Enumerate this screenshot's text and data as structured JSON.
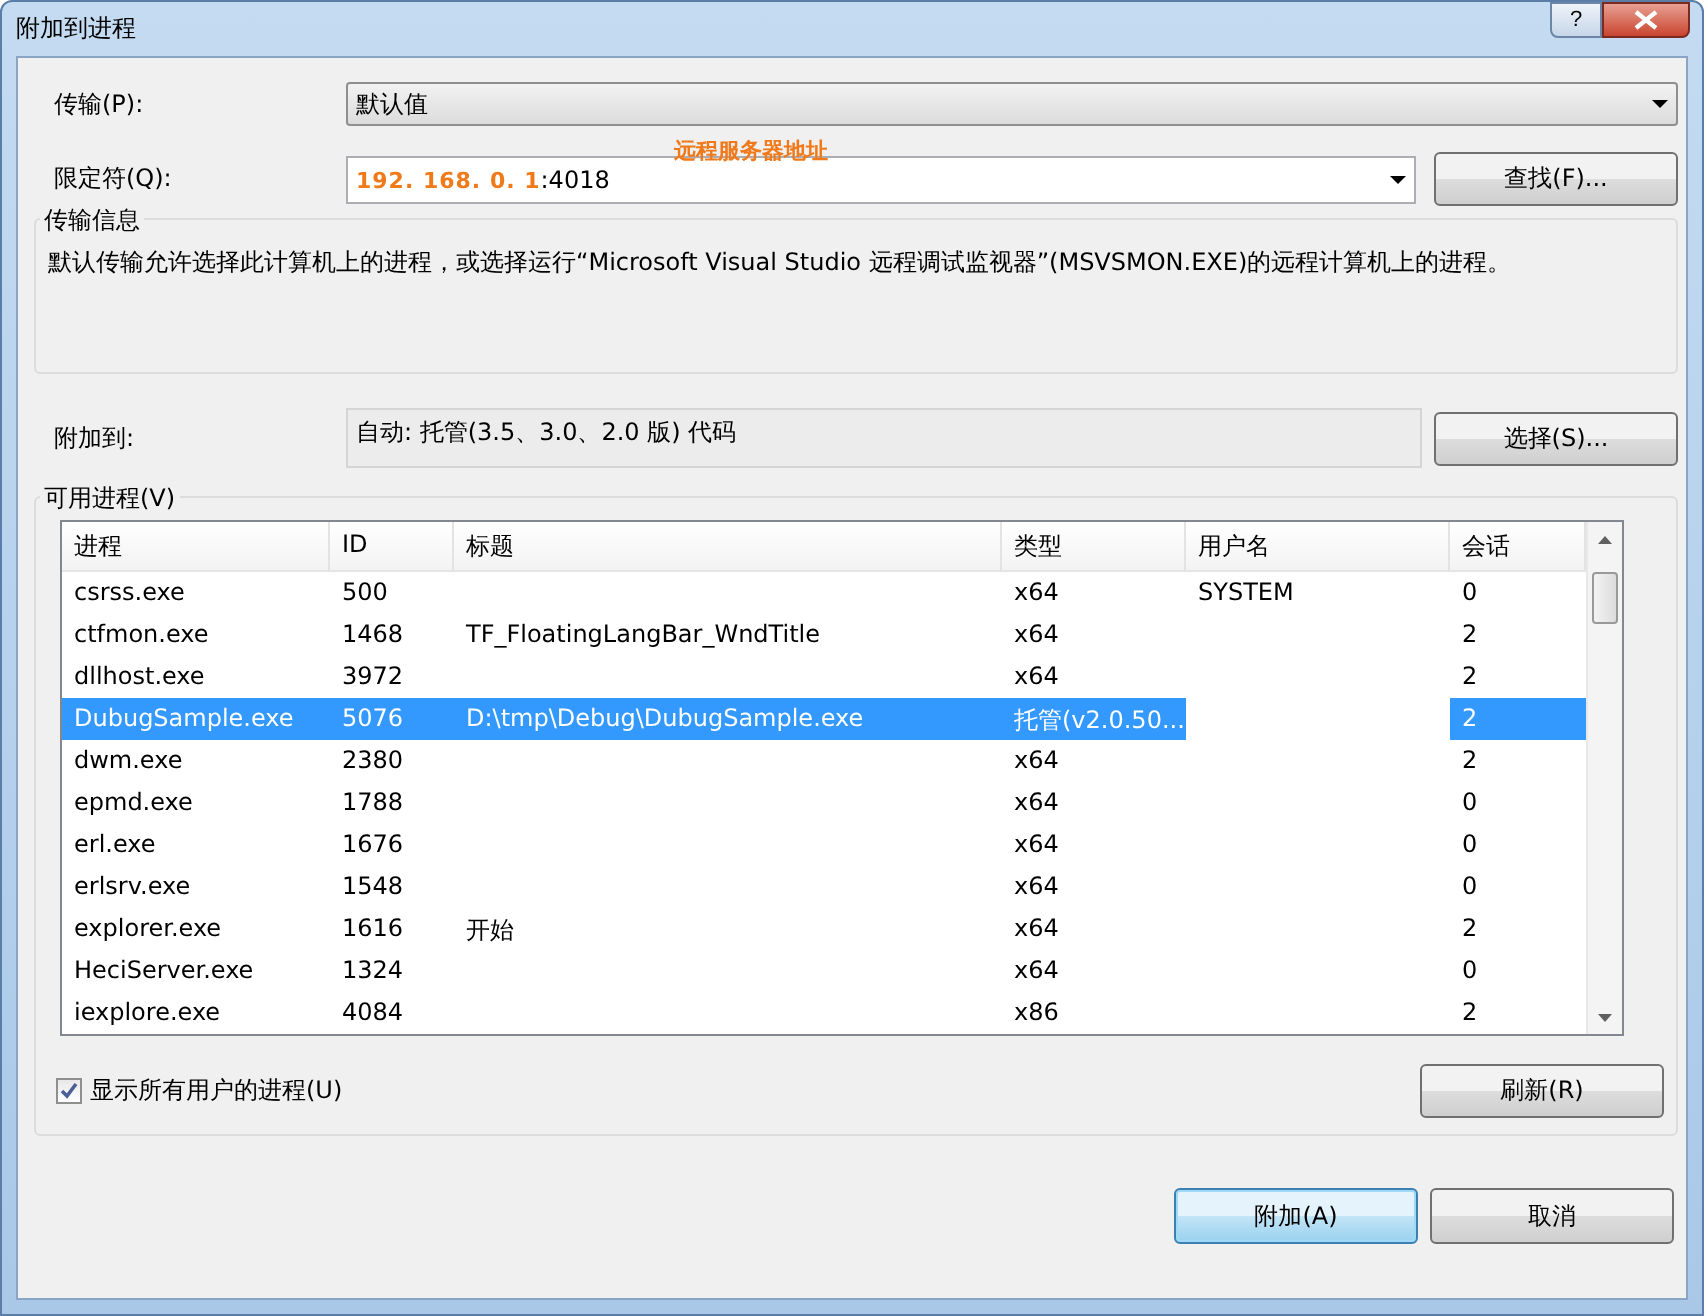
{
  "window": {
    "title": "附加到进程",
    "help_button": "?"
  },
  "transport": {
    "label": "传输(P):",
    "value": "默认值"
  },
  "qualifier": {
    "label": "限定符(Q):",
    "value": "**192. 168. 0. 1**:4018",
    "annotation": "远程服务器地址",
    "button": "查找(F)..."
  },
  "transport_info": {
    "title": "传输信息",
    "text": "默认传输允许选择此计算机上的进程，或选择运行“Microsoft Visual Studio 远程调试监视器”(MSVSMON.EXE)的远程计算机上的进程。"
  },
  "attach_to": {
    "label": "附加到:",
    "value": "自动: 托管(3.5、3.0、2.0 版) 代码",
    "button": "选择(S)..."
  },
  "processes": {
    "title": "可用进程(V)",
    "columns": [
      "进程",
      "ID",
      "标题",
      "类型",
      "用户名",
      "会话"
    ],
    "rows": [
      {
        "cells": [
          "csrss.exe",
          "500",
          "",
          "x64",
          "SYSTEM",
          "0"
        ],
        "selected": false
      },
      {
        "cells": [
          "ctfmon.exe",
          "1468",
          "TF_FloatingLangBar_WndTitle",
          "x64",
          "",
          "2"
        ],
        "selected": false
      },
      {
        "cells": [
          "dllhost.exe",
          "3972",
          "",
          "x64",
          "",
          "2"
        ],
        "selected": false
      },
      {
        "cells": [
          "DubugSample.exe",
          "5076",
          "D:\\tmp\\Debug\\DubugSample.exe",
          "托管(v2.0.50...",
          "",
          "2"
        ],
        "selected": true
      },
      {
        "cells": [
          "dwm.exe",
          "2380",
          "",
          "x64",
          "",
          "2"
        ],
        "selected": false
      },
      {
        "cells": [
          "epmd.exe",
          "1788",
          "",
          "x64",
          "",
          "0"
        ],
        "selected": false
      },
      {
        "cells": [
          "erl.exe",
          "1676",
          "",
          "x64",
          "",
          "0"
        ],
        "selected": false
      },
      {
        "cells": [
          "erlsrv.exe",
          "1548",
          "",
          "x64",
          "",
          "0"
        ],
        "selected": false
      },
      {
        "cells": [
          "explorer.exe",
          "1616",
          "开始",
          "x64",
          "",
          "2"
        ],
        "selected": false
      },
      {
        "cells": [
          "HeciServer.exe",
          "1324",
          "",
          "x64",
          "",
          "0"
        ],
        "selected": false
      },
      {
        "cells": [
          "iexplore.exe",
          "4084",
          "",
          "x86",
          "",
          "2"
        ],
        "selected": false
      }
    ],
    "show_all_users": {
      "label": "显示所有用户的进程(U)",
      "checked": true
    },
    "refresh_button": "刷新(R)"
  },
  "buttons": [
    {
      "label": "附加(A)",
      "default": true
    },
    {
      "label": "取消",
      "default": false
    }
  ]
}
